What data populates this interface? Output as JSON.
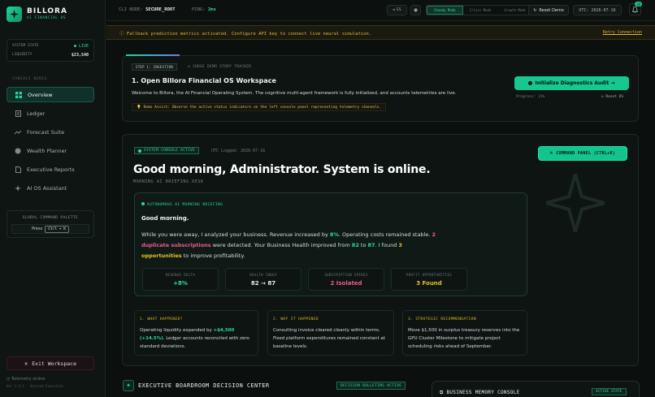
{
  "brand": {
    "name": "BILLORA",
    "subtitle": "AI FINANCIAL OS"
  },
  "sidebar": {
    "state_label": "SYSTEM STATE",
    "state_value": "● LIVE",
    "liquidity_label": "LIQUIDITY",
    "liquidity_value": "$23,540",
    "section_label": "CONSOLE NODES",
    "items": [
      {
        "label": "Overview",
        "icon": "grid-icon"
      },
      {
        "label": "Ledger",
        "icon": "document-icon"
      },
      {
        "label": "Forecast Suite",
        "icon": "trend-icon"
      },
      {
        "label": "Wealth Planner",
        "icon": "globe-icon"
      },
      {
        "label": "Executive Reports",
        "icon": "file-icon"
      },
      {
        "label": "AI OS Assistant",
        "icon": "sparkle-icon"
      }
    ],
    "palette_title": "GLOBAL COMMAND PALETTE",
    "palette_press": "Press",
    "palette_key": "Ctrl + K",
    "exit_label": "Exit Workspace",
    "telemetry": "Telemetry online",
    "version": "Ver 1.4.2 · Secured Execution"
  },
  "topbar": {
    "node_label": "CLI NODE:",
    "node_value": "SECURE_ROOT",
    "ping_label": "PING:",
    "ping_value": "2ms",
    "lang": "ES",
    "modes": [
      "Steady Mode",
      "Crisis Mode",
      "Growth Mode"
    ],
    "reset_demo": "Reset Demo",
    "utc": "UTC: 2026-07-16",
    "notif_count": "18"
  },
  "banner": {
    "text": "Fallback prediction metrics activated. Configure API key to connect live neural simulation.",
    "link": "Retry Connection"
  },
  "story": {
    "step": "STEP 1: INGESTION",
    "tracker": "JUDGE DEMO STORY TRACKER",
    "title": "1. Open Billora Financial OS Workspace",
    "body": "Welcome to Billora, the AI Financial Operating System. The cognitive multi-agent framework is fully initialized, and accounts telemetries are live.",
    "assist": "Demo Assist: Observe the active status indicators on the left console panel representing telemetry channels.",
    "cta": "Initialize Diagnostics Audit →",
    "progress": "Progress: 11%",
    "reset": "Reset OS"
  },
  "console": {
    "badge": "SYSTEM CONSOLE ACTIVE",
    "utc": "UTC Logged: 2026-07-16",
    "command": "COMMAND PANEL (CTRL+K)",
    "greeting": "Good morning, Administrator. System is online.",
    "desk": "MORNING AI BRIEFING DESK",
    "brief_header": "AUTONOMOUS AI MORNING BRIEFING",
    "brief_greet": "Good morning.",
    "brief_line1_a": "While you were away, I analyzed your business. Revenue increased by ",
    "brief_pct": "8%",
    "brief_line1_b": ". Operating costs remained stable. ",
    "brief_dup_num": "2",
    "brief_dup": "duplicate subscriptions",
    "brief_line2_b": " were detected. Your Business Health improved from ",
    "brief_h1": "82",
    "brief_to": " to ",
    "brief_h2": "87",
    "brief_found": ". I found ",
    "brief_opp_num": "3",
    "brief_opp": "opportunities",
    "brief_end": " to improve profitability.",
    "metrics": [
      {
        "label": "REVENUE DELTA",
        "value": "+8%",
        "color": "#2ed8a0"
      },
      {
        "label": "HEALTH INDEX",
        "value": "82 → 87",
        "color": "#e8eeec"
      },
      {
        "label": "SUBSCRIPTION SPIKES",
        "value": "2 Isolated",
        "color": "#f05a8a"
      },
      {
        "label": "PROFIT OPPORTUNITIES",
        "value": "3 Found",
        "color": "#e6c028"
      }
    ],
    "insights": [
      {
        "title": "1. WHAT HAPPENED?",
        "pre": "Operating liquidity expanded by ",
        "hl": "+$4,500 (+14.5%)",
        "post": ". Ledger accounts reconciled with zero standard deviations."
      },
      {
        "title": "2. WHY IT HAPPENED",
        "pre": "Consulting invoice cleared cleanly within terms. Fixed platform expenditures remained constant at baseline levels.",
        "hl": "",
        "post": ""
      },
      {
        "title": "3. STRATEGIC RECOMMENDATION",
        "pre": "Move $1,500 in surplus treasury reserves into the GPU Cluster Milestone to mitigate project scheduling risks ahead of September.",
        "hl": "",
        "post": ""
      }
    ]
  },
  "boardroom": {
    "title": "EXECUTIVE BOARDROOM DECISION CENTER",
    "badge": "DECISION BULLETINS ACTIVE",
    "memory_title": "BUSINESS MEMORY CONSOLE",
    "memory_badge": "ACTIVE STATE"
  }
}
